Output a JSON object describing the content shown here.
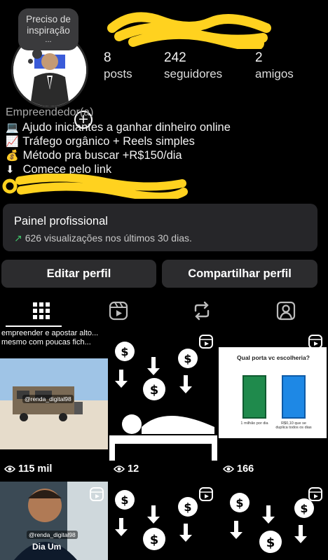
{
  "note": {
    "text": "Preciso de inspiração",
    "ellipsis": "..."
  },
  "stats": [
    {
      "value": "8",
      "label": "posts"
    },
    {
      "value": "242",
      "label": "seguidores"
    },
    {
      "value": "2",
      "label": "amigos"
    }
  ],
  "bio": {
    "category": "Empreendedor(a)",
    "lines": [
      {
        "icon": "laptop-icon",
        "glyph": "💻",
        "text": "Ajudo iniciantes a ganhar dinheiro online"
      },
      {
        "icon": "chart-up-icon",
        "glyph": "📈",
        "text": "Tráfego orgânico + Reels simples"
      },
      {
        "icon": "money-bag-icon",
        "glyph": "💰",
        "text": "Método pra buscar +R$150/dia"
      },
      {
        "icon": "down-arrow-icon",
        "glyph": "⬇",
        "text": "Comece pelo link"
      }
    ]
  },
  "pro_panel": {
    "title": "Painel profissional",
    "subtitle": "626 visualizações nos últimos 30 dias."
  },
  "buttons": {
    "edit": "Editar perfil",
    "share": "Compartilhar perfil"
  },
  "tabs": [
    {
      "name": "tab-grid",
      "icon": "grid-icon"
    },
    {
      "name": "tab-reels",
      "icon": "reels-icon"
    },
    {
      "name": "tab-reposts",
      "icon": "repost-icon"
    },
    {
      "name": "tab-tagged",
      "icon": "tagged-icon"
    }
  ],
  "posts": {
    "p1": {
      "caption_1": "empreender e apostar alto...",
      "caption_2": "mesmo com poucas fich...",
      "watermark": "@renda_digital98",
      "views": "115 mil"
    },
    "p2": {
      "views": "12"
    },
    "p3": {
      "question": "Qual porta vc escolheria?",
      "left_label": "1 milhão por dia",
      "right_label": "R$0,10 que se duplica todos os dias",
      "views": "166"
    },
    "p4": {
      "watermark": "@renda_digital98",
      "subtitle": "Dia Um"
    }
  },
  "colors": {
    "background": "#000000",
    "panel": "#262629",
    "button": "#2c2c2e",
    "accent_green": "#3fc46a",
    "scribble": "#ffd21f"
  }
}
